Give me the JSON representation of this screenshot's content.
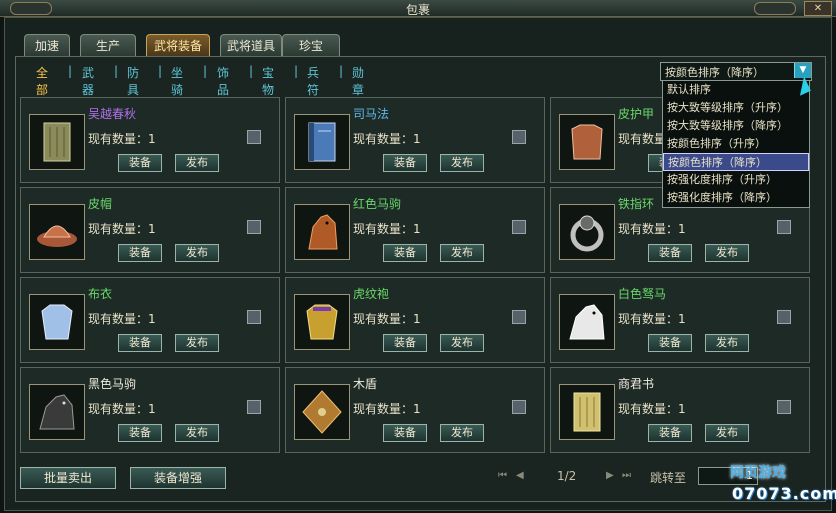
{
  "window": {
    "title": "包裹"
  },
  "tabs": [
    "加速",
    "生产",
    "武将装备",
    "武将道具",
    "珍宝"
  ],
  "active_tab": "武将装备",
  "filters": [
    "全部",
    "武器",
    "防具",
    "坐骑",
    "饰品",
    "宝物",
    "兵符",
    "勋章"
  ],
  "active_filter": "全部",
  "sort": {
    "selected": "按颜色排序（降序）",
    "options": [
      "默认排序",
      "按大致等级排序（升序）",
      "按大致等级排序（降序）",
      "按颜色排序（升序）",
      "按颜色排序（降序）",
      "按强化度排序（升序）",
      "按强化度排序（降序）"
    ]
  },
  "qty_label": "现有数量：1",
  "equip_label": "装备",
  "post_label": "发布",
  "items": [
    {
      "name": "吴越春秋",
      "color": "#b070e8",
      "icon": "scroll-icon"
    },
    {
      "name": "司马法",
      "color": "#5fb8e8",
      "icon": "book-icon"
    },
    {
      "name": "皮护甲",
      "color": "#6ad86a",
      "icon": "leather-armor-icon"
    },
    {
      "name": "皮帽",
      "color": "#6ad86a",
      "icon": "leather-hat-icon"
    },
    {
      "name": "红色马驹",
      "color": "#6ad86a",
      "icon": "red-horse-icon"
    },
    {
      "name": "铁指环",
      "color": "#6ad86a",
      "icon": "iron-ring-icon"
    },
    {
      "name": "布衣",
      "color": "#6ad86a",
      "icon": "cloth-robe-icon"
    },
    {
      "name": "虎纹袍",
      "color": "#6ad86a",
      "icon": "tiger-robe-icon"
    },
    {
      "name": "白色驽马",
      "color": "#6ad86a",
      "icon": "white-horse-icon"
    },
    {
      "name": "黑色马驹",
      "color": "#f0ece0",
      "icon": "black-horse-icon"
    },
    {
      "name": "木盾",
      "color": "#f0ece0",
      "icon": "wooden-shield-icon"
    },
    {
      "name": "商君书",
      "color": "#f0ece0",
      "icon": "scroll-book-icon"
    }
  ],
  "bottom": {
    "sell_label": "批量卖出",
    "enhance_label": "装备增强",
    "page": "1/2",
    "jump_label": "跳转至",
    "jump_value": "1"
  },
  "watermark": {
    "top": "网页游戏",
    "bottom": "07073.com"
  }
}
